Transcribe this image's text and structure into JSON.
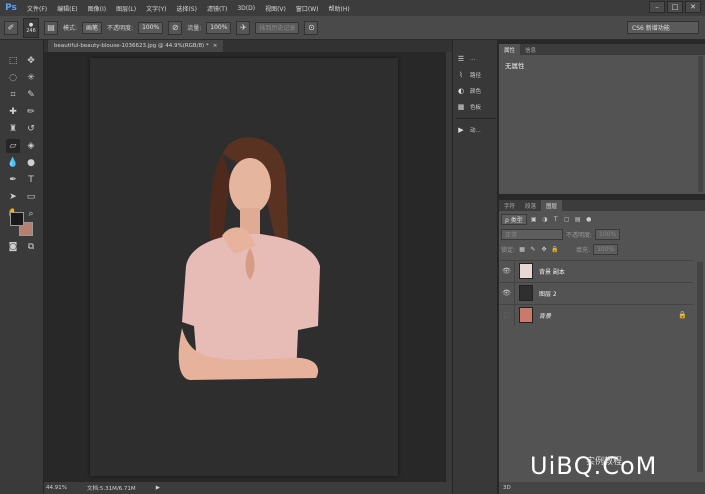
{
  "app": {
    "logo": "Ps"
  },
  "menubar": {
    "items": [
      "文件(F)",
      "编辑(E)",
      "图像(I)",
      "图层(L)",
      "文字(Y)",
      "选择(S)",
      "滤镜(T)",
      "3D(D)",
      "视图(V)",
      "窗口(W)",
      "帮助(H)"
    ],
    "window_controls": [
      "–",
      "□",
      "✕"
    ]
  },
  "options": {
    "brush_size": "246",
    "mode_label": "模式:",
    "mode_value": "画笔",
    "opacity_label": "不透明度:",
    "opacity_value": "100%",
    "flow_label": "流量:",
    "flow_value": "100%",
    "history_label": "抹到历史记录",
    "workspace": "CS6 新增功能"
  },
  "document": {
    "tab_title": "beautiful-beauty-blouse-1036623.jpg @ 44.9%(RGB/8) *",
    "tab_close": "×",
    "zoom": "44.91%",
    "doc_info": "文档:5.31M/6.71M"
  },
  "icon_panel": {
    "items": [
      {
        "icon": "sliders-icon",
        "label": "..."
      },
      {
        "icon": "paths-icon",
        "label": "路径"
      },
      {
        "icon": "color-icon",
        "label": "颜色"
      },
      {
        "icon": "swatches-icon",
        "label": "色板"
      },
      {
        "icon": "play-icon",
        "label": "动..."
      }
    ]
  },
  "properties_panel": {
    "tabs": [
      "属性",
      "信息"
    ],
    "empty_text": "无属性"
  },
  "layers_panel": {
    "tabs": [
      "字符",
      "段落",
      "图层"
    ],
    "filter_kind": "ρ 类型",
    "blend_mode": "正常",
    "opacity_label": "不透明度:",
    "opacity_value": "100%",
    "lock_label": "锁定:",
    "fill_label": "填充:",
    "fill_value": "100%",
    "layers": [
      {
        "name": "背景 副本",
        "visible": true,
        "italic": false,
        "locked": false,
        "thumb": "#e8d8d4"
      },
      {
        "name": "图层 2",
        "visible": true,
        "italic": false,
        "locked": false,
        "thumb": "#2f2f2f"
      },
      {
        "name": "背景",
        "visible": false,
        "italic": true,
        "locked": true,
        "thumb": "#c97a6a"
      }
    ],
    "bottom_label": "3D"
  },
  "watermark": {
    "brand": "UiBQ.CoM",
    "subtitle": "实例教程"
  },
  "colors": {
    "accent": "#5aa0ff",
    "foreground_swatch": "#1a1a1a",
    "background_swatch": "#b67f72"
  }
}
